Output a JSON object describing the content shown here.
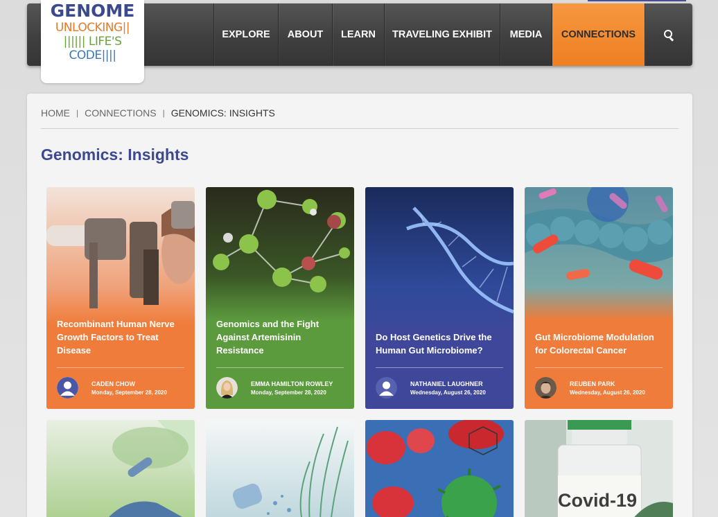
{
  "logo": {
    "line1": "GENOME",
    "line2": "UNLOCKING||",
    "line3": "|||||| LIFE'S",
    "line4": "CODE||||"
  },
  "nav": {
    "items": [
      {
        "label": "EXPLORE"
      },
      {
        "label": "ABOUT"
      },
      {
        "label": "LEARN"
      },
      {
        "label": "TRAVELING EXHIBIT"
      },
      {
        "label": "MEDIA"
      },
      {
        "label": "CONNECTIONS",
        "active": true
      }
    ],
    "search_icon": "search-icon"
  },
  "breadcrumb": {
    "items": [
      "HOME",
      "CONNECTIONS",
      "GENOMICS: INSIGHTS"
    ],
    "separator": "|"
  },
  "page_title": "Genomics: Insights",
  "cards": [
    {
      "title": "Recombinant Human Nerve Growth Factors to Treat Disease",
      "author": "CADEN CHOW",
      "date": "Monday, September 28, 2020",
      "color": "#ef7c3a",
      "avatar": "default-user-avatar"
    },
    {
      "title": "Genomics and the Fight Against Artemisinin Resistance",
      "author": "EMMA HAMILTON ROWLEY",
      "date": "Monday, September 28, 2020",
      "color": "#5c9a3e",
      "avatar": "photo-avatar"
    },
    {
      "title": "Do Host Genetics Drive the Human Gut Microbiome?",
      "author": "NATHANIEL LAUGHNER",
      "date": "Wednesday, August 26, 2020",
      "color": "#3f479a",
      "avatar": "default-user-avatar"
    },
    {
      "title": "Gut Microbiome Modulation for Colorectal Cancer",
      "author": "REUBEN PARK",
      "date": "Wednesday, August 26, 2020",
      "color": "#ef7c3a",
      "avatar": "photo-avatar"
    }
  ],
  "second_row": {
    "covid_label": "Covid-19"
  },
  "colors": {
    "brand_blue": "#3c4891",
    "accent_orange": "#f28a2e",
    "nav_bg": "#424242"
  }
}
